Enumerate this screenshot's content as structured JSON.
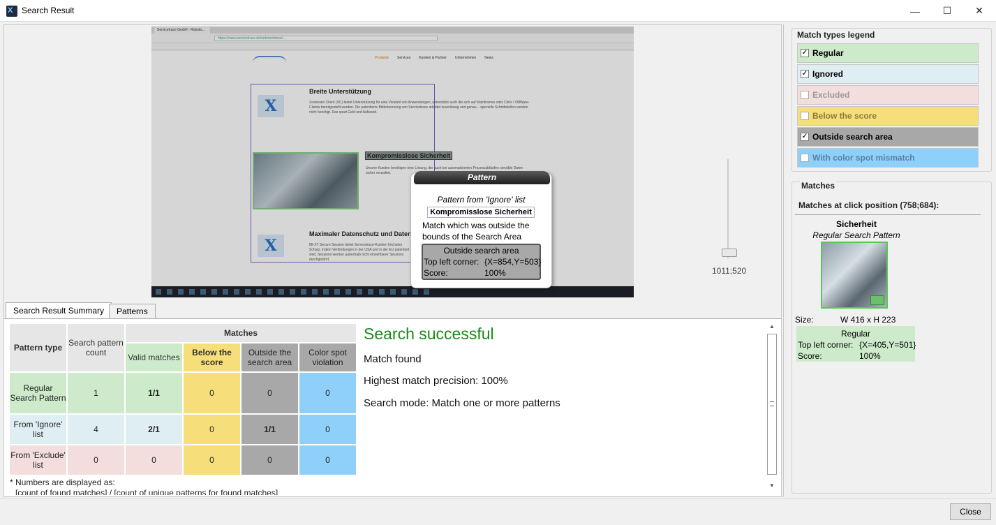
{
  "window": {
    "title": "Search Result",
    "minimize": "—",
    "maximize": "☐",
    "close": "✕"
  },
  "screenshot": {
    "tab_label": "Servicetrace GmbH - Robotic...",
    "url": "https://www.servicetrace.de/unternehmen/...",
    "nav": [
      "Produkte",
      "Services",
      "Kunden & Partner",
      "Unternehmen",
      "News"
    ],
    "heading1": "Breite Unterstützung",
    "body1": "Xceleratio Client (XC) bietet Unterstützung für eine Vielzahl von Anwendungen, unterstützt auch die sich auf Mainframes oder Citrix / VMWare-Clients bereitgestellt werden. Die patentierte Bilderkennung von Servicetrace arbeitet zuverlässig und genau – spezielle Schnittstellen werden nicht benötigt. Das spart Geld und Aufwand.",
    "heading2": "Kompromisslose Sicherheit",
    "body2": "Unsere Kunden benötigen eine Lösung, die auch bei automatisierten Prozessabläufen sensible Daten sicher verwaltet.",
    "heading3": "Maximaler Datenschutz und Datensicherheit",
    "body3": "MI-XT Secure Session bietet Servicetrace-Kunden höchsten Schutz, indem Verbindungen in der USA und in der EU patentiert sind. Sessions werden außerhalb nicht einsehbarer Sessions durchgeführt."
  },
  "popup": {
    "title": "Pattern",
    "subtitle": "Pattern from 'Ignore' list",
    "pattern_text": "Kompromisslose Sicherheit",
    "desc": "Match which was outside the bounds of the Search Area",
    "box_title": "Outside search area",
    "corner_label": "Top left corner:",
    "corner_value": "{X=854,Y=503}",
    "score_label": "Score:",
    "score_value": "100%"
  },
  "coordinate": "1011;520",
  "tabs": [
    "Search Result Summary",
    "Patterns"
  ],
  "summary": {
    "headers": {
      "pattern_type": "Pattern type",
      "search_count": "Search pattern count",
      "matches": "Matches",
      "valid": "Valid matches",
      "below": "Below the score",
      "outside": "Outside the search area",
      "color": "Color spot violation"
    },
    "rows": [
      {
        "type": "Regular Search Pattern",
        "count": "1",
        "valid": "1/1",
        "below": "0",
        "outside": "0",
        "color": "0"
      },
      {
        "type": "From 'Ignore' list",
        "count": "4",
        "valid": "2/1",
        "below": "0",
        "outside": "1/1",
        "color": "0"
      },
      {
        "type": "From 'Exclude' list",
        "count": "0",
        "valid": "0",
        "below": "0",
        "outside": "0",
        "color": "0"
      }
    ],
    "footnote": "* Numbers are displayed as:",
    "footnote2": "[count of found matches] / [count of unique patterns for found matches]"
  },
  "result": {
    "title": "Search successful",
    "line1": "Match found",
    "line2": "Highest match precision: 100%",
    "line3": "Search mode: Match one or more patterns"
  },
  "legend": {
    "title": "Match types legend",
    "items": [
      {
        "label": "Regular",
        "checked": true,
        "color": "#cdeacb"
      },
      {
        "label": "Ignored",
        "checked": true,
        "color": "#dfeef3"
      },
      {
        "label": "Excluded",
        "checked": false,
        "color": "#f3dedd"
      },
      {
        "label": "Below the score",
        "checked": false,
        "color": "#f6de7a"
      },
      {
        "label": "Outside search area",
        "checked": true,
        "color": "#a8a8a8"
      },
      {
        "label": "With color spot mismatch",
        "checked": false,
        "color": "#8fd0fa"
      }
    ]
  },
  "matches": {
    "title": "Matches",
    "click_position": "Matches at click position (758;684):",
    "name": "Sicherheit",
    "kind": "Regular Search Pattern",
    "size_label": "Size:",
    "size_value": "W 416 x H 223",
    "box_title": "Regular",
    "corner_label": "Top left corner:",
    "corner_value": "{X=405,Y=501}",
    "score_label": "Score:",
    "score_value": "100%"
  },
  "close_button": "Close"
}
